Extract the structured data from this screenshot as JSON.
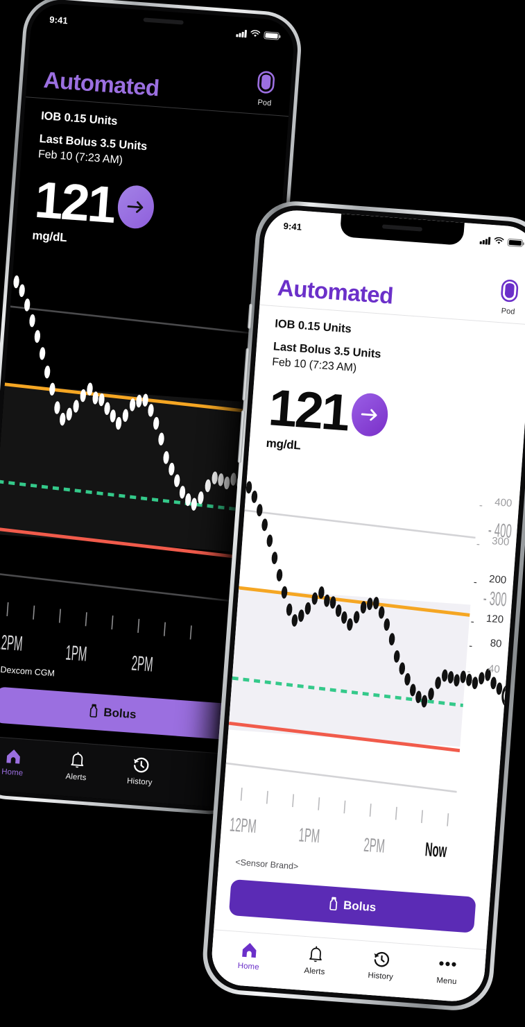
{
  "theme": {
    "accent_light": "#6B30C9",
    "accent_dark": "#9B6FE0",
    "bolus_light": "#5B2BB5",
    "high_limit_color": "#F5A623",
    "low_limit_color": "#F15B4B",
    "target_color": "#34C98A",
    "band_fill": "#F1F0F5"
  },
  "dark_phone": {
    "status": {
      "time": "9:41",
      "signal_icon": "cellular-signal-icon",
      "wifi_icon": "wifi-icon",
      "battery_icon": "battery-icon"
    },
    "header": {
      "title": "Automated",
      "pod_label": "Pod",
      "pod_icon": "pod-icon"
    },
    "info": {
      "iob": "IOB 0.15 Units",
      "last_bolus": "Last Bolus 3.5 Units",
      "last_bolus_time": "Feb 10 (7:23 AM)"
    },
    "glucose": {
      "value": "121",
      "unit": "mg/dL",
      "trend_icon": "arrow-right-icon"
    },
    "chart": {
      "sensor_brand": "Dexcom CGM"
    },
    "bolus_button": {
      "label": "Bolus",
      "icon": "vial-icon"
    },
    "tabs": [
      {
        "label": "Home",
        "icon": "home-icon",
        "active": true
      },
      {
        "label": "Alerts",
        "icon": "bell-icon",
        "active": false
      },
      {
        "label": "History",
        "icon": "history-clock-icon",
        "active": false
      }
    ]
  },
  "light_phone": {
    "status": {
      "time": "9:41",
      "signal_icon": "cellular-signal-icon",
      "wifi_icon": "wifi-icon",
      "battery_icon": "battery-icon"
    },
    "header": {
      "title": "Automated",
      "pod_label": "Pod",
      "pod_icon": "pod-icon"
    },
    "info": {
      "iob": "IOB 0.15 Units",
      "last_bolus": "Last Bolus 3.5 Units",
      "last_bolus_time": "Feb 10 (7:23 AM)"
    },
    "glucose": {
      "value": "121",
      "unit": "mg/dL",
      "trend_icon": "arrow-right-icon"
    },
    "chart": {
      "sensor_brand": "<Sensor Brand>"
    },
    "bolus_button": {
      "label": "Bolus",
      "icon": "vial-icon"
    },
    "tabs": [
      {
        "label": "Home",
        "icon": "home-icon",
        "active": true
      },
      {
        "label": "Alerts",
        "icon": "bell-icon",
        "active": false
      },
      {
        "label": "History",
        "icon": "history-clock-icon",
        "active": false
      },
      {
        "label": "Menu",
        "icon": "ellipsis-icon",
        "active": false
      }
    ]
  },
  "chart_data": {
    "type": "scatter",
    "title": "",
    "xlabel": "",
    "ylabel": "mg/dL",
    "ylim": [
      40,
      400
    ],
    "yticks": [
      400,
      300,
      200,
      120,
      80,
      40
    ],
    "ytick_labels": [
      "400",
      "300",
      "200",
      "120",
      "80",
      "40"
    ],
    "xtick_labels": [
      "12PM",
      "1PM",
      "2PM",
      "Now"
    ],
    "xtick_positions": [
      0.07,
      0.37,
      0.66,
      0.95
    ],
    "minor_tick_positions": [
      0.07,
      0.175,
      0.265,
      0.37,
      0.465,
      0.565,
      0.66,
      0.755,
      0.855,
      0.95
    ],
    "grid": true,
    "gridlines": [
      400,
      300,
      40
    ],
    "high_limit": 200,
    "low_limit": 80,
    "target": 120,
    "target_style": "dashed",
    "in_range_band": [
      80,
      200
    ],
    "current_value": 121,
    "current_marker": "open-circle",
    "series": [
      {
        "name": "CGM glucose",
        "marker": "dot",
        "values": [
          305,
          296,
          283,
          268,
          252,
          236,
          218,
          201,
          186,
          176,
          180,
          188,
          197,
          203,
          196,
          195,
          188,
          182,
          176,
          183,
          192,
          196,
          198,
          190,
          180,
          168,
          154,
          146,
          138,
          130,
          125,
          122,
          127,
          135,
          141,
          140,
          139,
          142,
          140,
          138,
          141,
          144,
          147,
          144,
          140,
          134,
          128,
          121
        ]
      }
    ]
  }
}
